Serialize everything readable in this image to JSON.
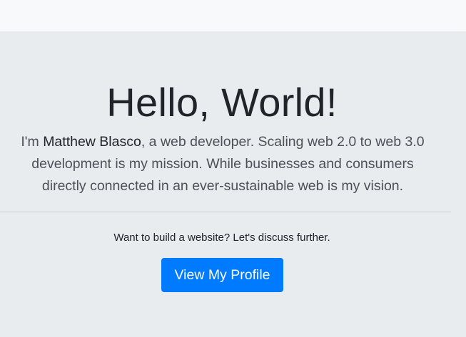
{
  "hero": {
    "title": "Hello, World!",
    "lead_prefix": "I'm ",
    "lead_name": "Matthew Blasco",
    "lead_suffix": ", a web developer. Scaling web 2.0 to web 3.0 development is my mission. While businesses and consumers directly connected in an ever-sustainable web is my vision.",
    "cta_text": "Want to build a website? Let's discuss further.",
    "button_label": "View My Profile"
  },
  "colors": {
    "background": "#e9ecef",
    "topbar": "#f8f9fa",
    "primary_button": "#007bff",
    "text": "#212529"
  }
}
